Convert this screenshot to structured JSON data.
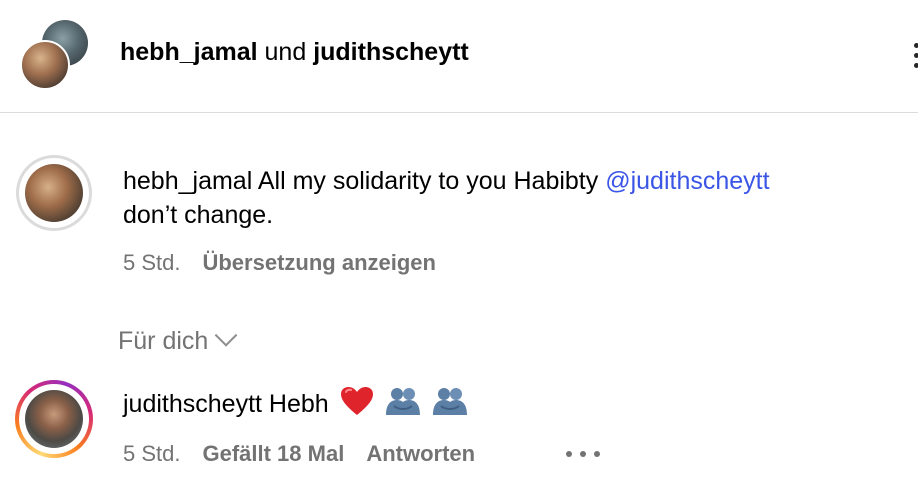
{
  "header": {
    "user1": "hebh_jamal",
    "joiner": "und",
    "user2": "judithscheytt"
  },
  "comments": [
    {
      "username": "hebh_jamal",
      "text_before": "All my solidarity to you Habibty",
      "mention": "@judithscheytt",
      "text_after": "don’t change.",
      "time": "5 Std.",
      "translate_label": "Übersetzung anzeigen"
    },
    {
      "username": "judithscheytt",
      "text": "Hebh",
      "emojis": [
        "red-heart-icon",
        "hugging-people-icon",
        "hugging-people-icon"
      ],
      "time": "5 Std.",
      "likes_label": "Gefällt 18 Mal",
      "reply_label": "Antworten"
    }
  ],
  "section": {
    "label": "Für dich"
  },
  "colors": {
    "mention": "#3b55e6",
    "meta": "#737373",
    "divider": "#dbdbdb",
    "heart": "#e0242c",
    "hug": "#5c7fa6"
  }
}
